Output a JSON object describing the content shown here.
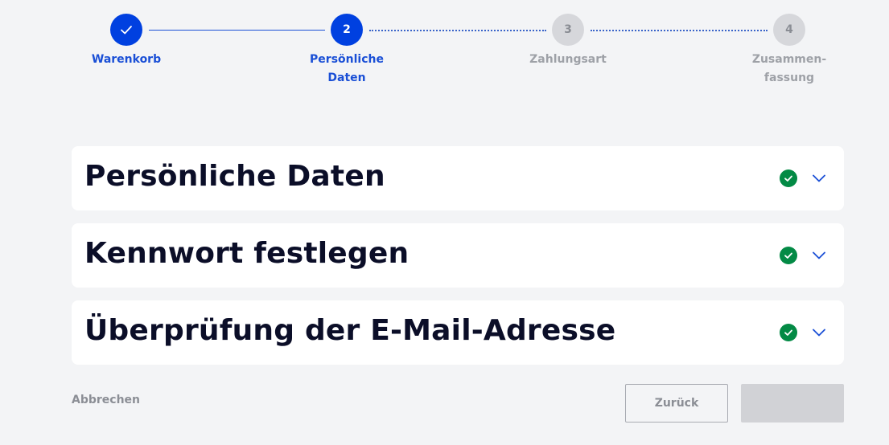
{
  "stepper": {
    "steps": [
      {
        "number": "",
        "label": "Warenkorb",
        "state": "done"
      },
      {
        "number": "2",
        "label_line1": "Persönliche",
        "label_line2": "Daten",
        "state": "active"
      },
      {
        "number": "3",
        "label": "Zahlungsart",
        "state": "pending"
      },
      {
        "number": "4",
        "label_line1": "Zusammen-",
        "label_line2": "fassung",
        "state": "pending"
      }
    ]
  },
  "panels": [
    {
      "title": "Persönliche Daten",
      "status": "complete"
    },
    {
      "title": "Kennwort festlegen",
      "status": "complete"
    },
    {
      "title": "Überprüfung der E-Mail-Adresse",
      "status": "complete"
    }
  ],
  "footer": {
    "cancel_label": "Abbrechen",
    "back_label": "Zurück",
    "next_label": ""
  },
  "colors": {
    "accent": "#0040e0",
    "success": "#038a45",
    "background": "#f3f4f6",
    "disabled": "#d1d2d6"
  },
  "icons": {
    "step_done": "checkmark-icon",
    "panel_status": "check-circle-icon",
    "panel_toggle": "chevron-down-icon"
  }
}
